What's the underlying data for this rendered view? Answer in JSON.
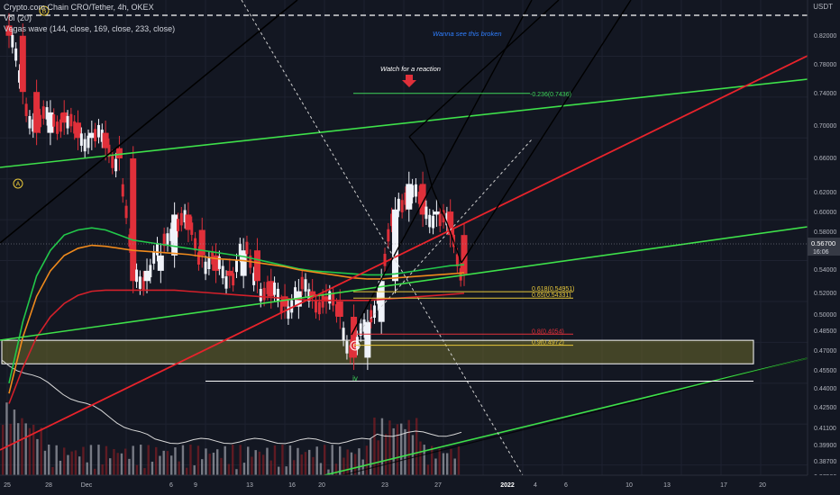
{
  "header": {
    "symbol_line": "Crypto.com Chain CRO/Tether, 4h, OKEX",
    "volume_line": "Vol (20)",
    "indicator_line": "Vegas wave (144, close, 169, close, 233, close)",
    "currency": "USDT"
  },
  "price_axis": {
    "labels": [
      "0.82000",
      "0.78000",
      "0.74000",
      "0.70000",
      "0.66000",
      "0.62000",
      "0.60000",
      "0.58000",
      "0.54000",
      "0.52000",
      "0.50000",
      "0.48500",
      "0.47000",
      "0.45500",
      "0.44000",
      "0.42500",
      "0.41100",
      "0.39900",
      "0.38700",
      "0.37500"
    ],
    "current_price": "0.56700",
    "countdown": "16:06"
  },
  "time_axis": {
    "labels": [
      "25",
      "28",
      "Dec",
      "6",
      "9",
      "13",
      "16",
      "20",
      "23",
      "27",
      "2022",
      "4",
      "6",
      "10",
      "13",
      "17",
      "20"
    ]
  },
  "annotations": {
    "broken_note": "Wanna see this broken",
    "reaction_note": "Watch for a reaction",
    "fib_0236": "-0.236(0.7436)",
    "fib_0618": "0.618(0.54951)",
    "fib_065": "0.65(0.54331)",
    "fib_high_red": "0.8(0.4054)",
    "fib_low_yellow": "0.9(0.4972)",
    "wave_a": "A",
    "wave_b": "B",
    "wave_c": "C",
    "wave_iv": "iv"
  },
  "colors": {
    "background": "#131722",
    "grid": "#1e2230",
    "candle_up": "#f0f3fa",
    "candle_down": "#e0303a",
    "wave_green": "#22c84a",
    "wave_orange": "#f08a1c",
    "wave_red": "#d4202a",
    "trend_green": "#3ee04a",
    "trend_red": "#e8232b",
    "zone_fill": "#6b6a2c",
    "fib_yellow": "#e8c83a",
    "fib_green": "#3ed65a",
    "note_blue": "#2f7fff"
  },
  "chart_data": {
    "type": "candlestick",
    "title": "Crypto.com Chain CRO/Tether, 4h, OKEX",
    "xlabel": "",
    "ylabel": "",
    "ylim": [
      0.37,
      0.835
    ],
    "price_series": [
      {
        "t": "Nov 25",
        "close": 0.8
      },
      {
        "t": "Nov 26",
        "close": 0.745
      },
      {
        "t": "Nov 27",
        "close": 0.705
      },
      {
        "t": "Nov 28",
        "close": 0.725
      },
      {
        "t": "Nov 29",
        "close": 0.715
      },
      {
        "t": "Nov 30",
        "close": 0.7
      },
      {
        "t": "Dec 1",
        "close": 0.705
      },
      {
        "t": "Dec 2",
        "close": 0.69
      },
      {
        "t": "Dec 3",
        "close": 0.68
      },
      {
        "t": "Dec 4",
        "close": 0.56
      },
      {
        "t": "Dec 5",
        "close": 0.57
      },
      {
        "t": "Dec 6",
        "close": 0.585
      },
      {
        "t": "Dec 7",
        "close": 0.625
      },
      {
        "t": "Dec 8",
        "close": 0.61
      },
      {
        "t": "Dec 9",
        "close": 0.585
      },
      {
        "t": "Dec 10",
        "close": 0.57
      },
      {
        "t": "Dec 11",
        "close": 0.565
      },
      {
        "t": "Dec 12",
        "close": 0.59
      },
      {
        "t": "Dec 13",
        "close": 0.56
      },
      {
        "t": "Dec 14",
        "close": 0.545
      },
      {
        "t": "Dec 15",
        "close": 0.535
      },
      {
        "t": "Dec 16",
        "close": 0.55
      },
      {
        "t": "Dec 17",
        "close": 0.545
      },
      {
        "t": "Dec 18",
        "close": 0.54
      },
      {
        "t": "Dec 19",
        "close": 0.525
      },
      {
        "t": "Dec 20",
        "close": 0.485
      },
      {
        "t": "Dec 21",
        "close": 0.52
      },
      {
        "t": "Dec 22",
        "close": 0.56
      },
      {
        "t": "Dec 23",
        "close": 0.63
      },
      {
        "t": "Dec 24",
        "close": 0.655
      },
      {
        "t": "Dec 25",
        "close": 0.625
      },
      {
        "t": "Dec 26",
        "close": 0.628
      },
      {
        "t": "Dec 27",
        "close": 0.605
      },
      {
        "t": "Dec 28",
        "close": 0.567
      }
    ],
    "moving_averages": [
      {
        "name": "144",
        "values": [
          0.46,
          0.52,
          0.565,
          0.59,
          0.605,
          0.61,
          0.612,
          0.61,
          0.605,
          0.6,
          0.598,
          0.596,
          0.594,
          0.592,
          0.59,
          0.588,
          0.586,
          0.584,
          0.581,
          0.578,
          0.575,
          0.572,
          0.57,
          0.569,
          0.568,
          0.567,
          0.566,
          0.566,
          0.567,
          0.569,
          0.571,
          0.573,
          0.575,
          0.576
        ]
      },
      {
        "name": "169",
        "values": [
          0.45,
          0.505,
          0.545,
          0.57,
          0.585,
          0.592,
          0.595,
          0.594,
          0.592,
          0.59,
          0.589,
          0.588,
          0.587,
          0.586,
          0.584,
          0.582,
          0.581,
          0.58,
          0.578,
          0.576,
          0.574,
          0.571,
          0.569,
          0.567,
          0.565,
          0.563,
          0.562,
          0.562,
          0.563,
          0.564,
          0.565,
          0.566,
          0.567,
          0.568
        ]
      },
      {
        "name": "233",
        "values": [
          0.44,
          0.475,
          0.505,
          0.525,
          0.538,
          0.546,
          0.55,
          0.551,
          0.551,
          0.551,
          0.551,
          0.551,
          0.551,
          0.55,
          0.549,
          0.548,
          0.547,
          0.546,
          0.545,
          0.544,
          0.543,
          0.542,
          0.541,
          0.541,
          0.541,
          0.541,
          0.541,
          0.542,
          0.543,
          0.544,
          0.545,
          0.546,
          0.547,
          0.548
        ]
      }
    ],
    "fib_levels": [
      {
        "label": "-0.236(0.7436)",
        "price": 0.7436
      },
      {
        "label": "0.618(0.54951)",
        "price": 0.54951
      },
      {
        "label": "0.65(0.54331)",
        "price": 0.54331
      },
      {
        "label": "0.8(0.4054)",
        "price": 0.508
      },
      {
        "label": "0.9(0.4972)",
        "price": 0.4972
      }
    ],
    "horizontal_levels": [
      {
        "name": "dashed-resistance",
        "price": 0.82
      },
      {
        "name": "support-white",
        "price": 0.462
      }
    ],
    "support_zone": {
      "top": 0.502,
      "bottom": 0.479
    },
    "volume_axis_note": "volume histogram at bottom (relative)"
  }
}
